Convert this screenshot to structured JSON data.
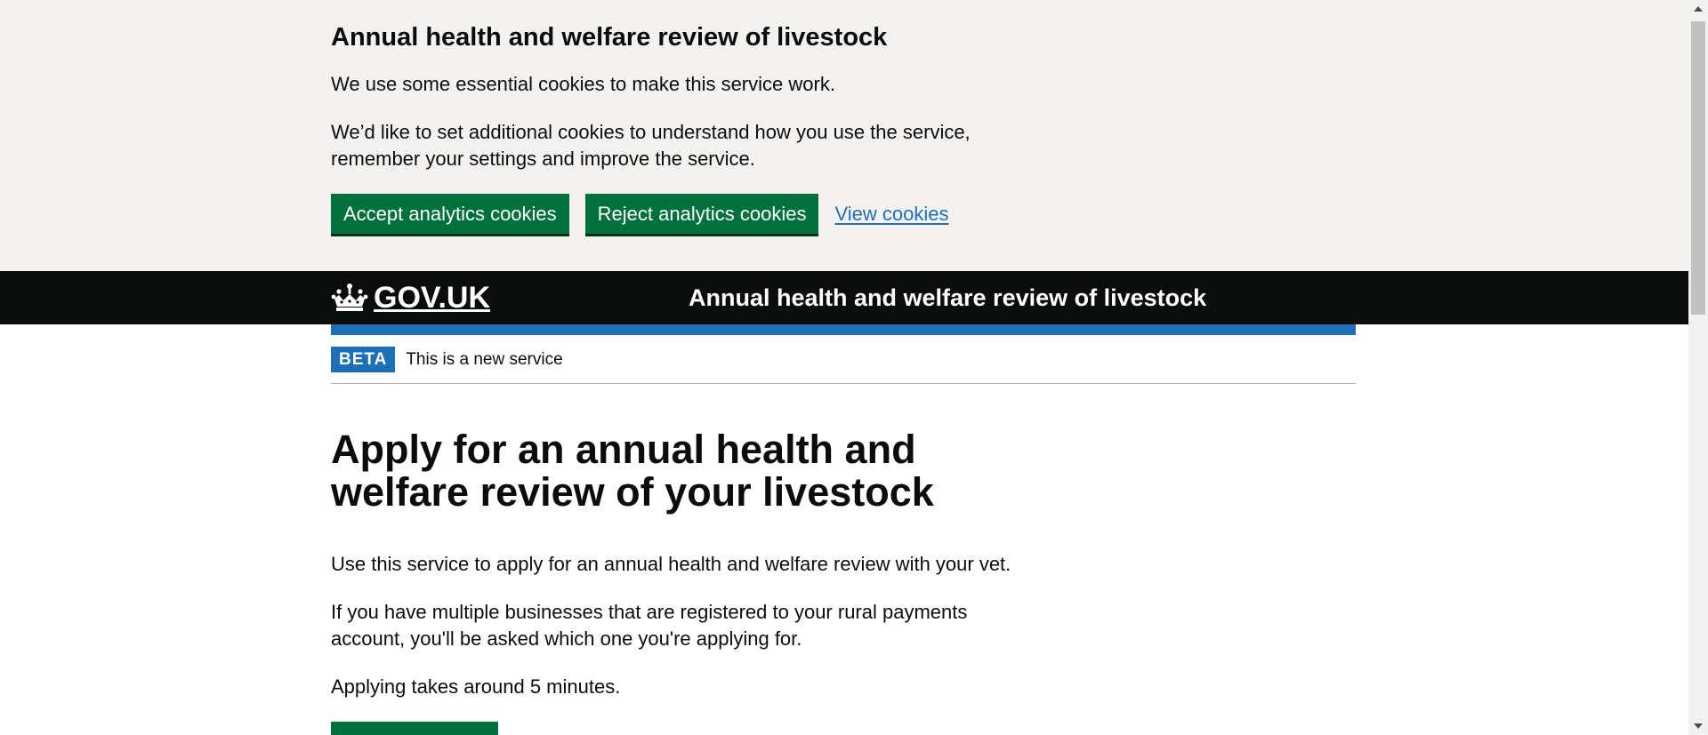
{
  "cookie_banner": {
    "title": "Annual health and welfare review of livestock",
    "paragraph_1": "We use some essential cookies to make this service work.",
    "paragraph_2": "We’d like to set additional cookies to understand how you use the service, remember your settings and improve the service.",
    "accept_label": "Accept analytics cookies",
    "reject_label": "Reject analytics cookies",
    "view_label": "View cookies"
  },
  "header": {
    "logo_text": "GOV.UK",
    "logo_icon": "crown-icon",
    "service_name": "Annual health and welfare review of livestock"
  },
  "phase_banner": {
    "tag": "BETA",
    "text": "This is a new service"
  },
  "main": {
    "title": "Apply for an annual health and welfare review of your livestock",
    "paragraphs": [
      "Use this service to apply for an annual health and welfare review with your vet.",
      "If you have multiple businesses that are registered to your rural payments account, you'll be asked which one you're applying for.",
      "Applying takes around 5 minutes."
    ]
  },
  "colors": {
    "banner_bg": "#f3f2f1",
    "header_bg": "#0b0c0c",
    "brand_blue": "#1d70b8",
    "button_green": "#00703c",
    "text": "#0b0c0c"
  }
}
